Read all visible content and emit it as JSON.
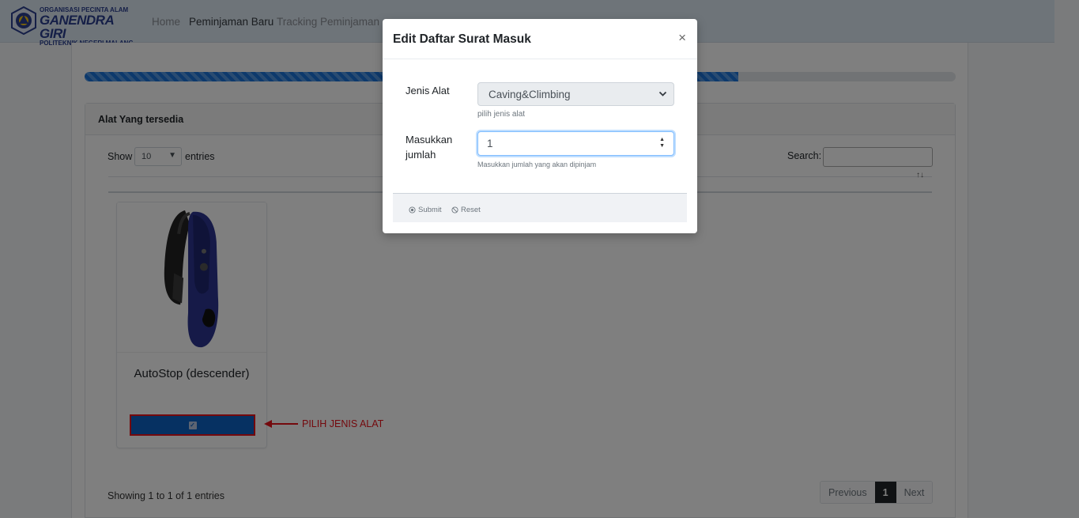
{
  "navbar": {
    "logo_line1": "ORGANISASI PECINTA ALAM",
    "logo_line2": "GANENDRA GIRI",
    "logo_line3": "POLITEKNIK NEGERI MALANG",
    "links": [
      "Home",
      "Peminjaman Baru",
      "Tracking Peminjaman"
    ]
  },
  "progress": {
    "value_percent": 75
  },
  "panel": {
    "title": "Alat Yang tersedia",
    "show_label": "Show",
    "entries_value": "10",
    "entries_label": "entries",
    "search_label": "Search:"
  },
  "product": {
    "title": "AutoStop (descender)"
  },
  "annotation": {
    "text": "PILIH JENIS ALAT",
    "color": "#e8131b"
  },
  "footer": {
    "showing": "Showing 1 to 1 of 1 entries",
    "previous": "Previous",
    "page": "1",
    "next": "Next"
  },
  "modal": {
    "title": "Edit Daftar Surat Masuk",
    "close": "×",
    "field1_label": "Jenis Alat",
    "field1_value": "Caving&Climbing",
    "field1_help": "pilih jenis alat",
    "field2_label_a": "Masukkan",
    "field2_label_b": "jumlah",
    "field2_value": "1",
    "field2_help": "Masukkan jumlah yang akan dipinjam",
    "submit": "Submit",
    "reset": "Reset"
  },
  "colors": {
    "primary": "#0d62c4",
    "progress": "#1a73d9",
    "navbar": "#dde8f2"
  }
}
